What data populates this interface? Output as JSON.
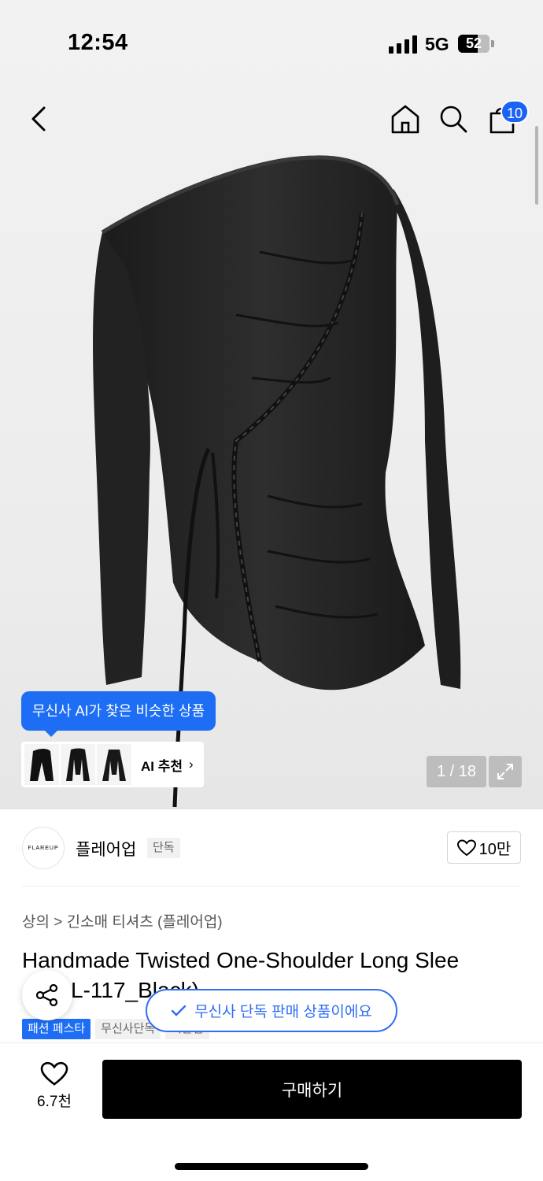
{
  "status_bar": {
    "time": "12:54",
    "network": "5G",
    "battery": "52"
  },
  "nav": {
    "cart_count": "10"
  },
  "gallery": {
    "page_indicator": "1 / 18"
  },
  "ai_recommend": {
    "tooltip": "무신사 AI가 찾은 비슷한 상품",
    "label": "AI 추천",
    "arrow": "›"
  },
  "brand": {
    "logo_text": "FLAREUP",
    "name": "플레어업",
    "tag": "단독",
    "likes": "10만"
  },
  "breadcrumb": "상의 > 긴소매 티셔츠 (플레어업)",
  "product": {
    "title": "Handmade Twisted One-Shoulder Long Slee",
    "title_line2": "L-117_Black)",
    "tags": [
      "패션 페스타",
      "무신사단독",
      "시즌컴"
    ]
  },
  "toast": "무신사 단독 판매 상품이에요",
  "bottom": {
    "wish_count": "6.7천",
    "buy_label": "구매하기"
  }
}
